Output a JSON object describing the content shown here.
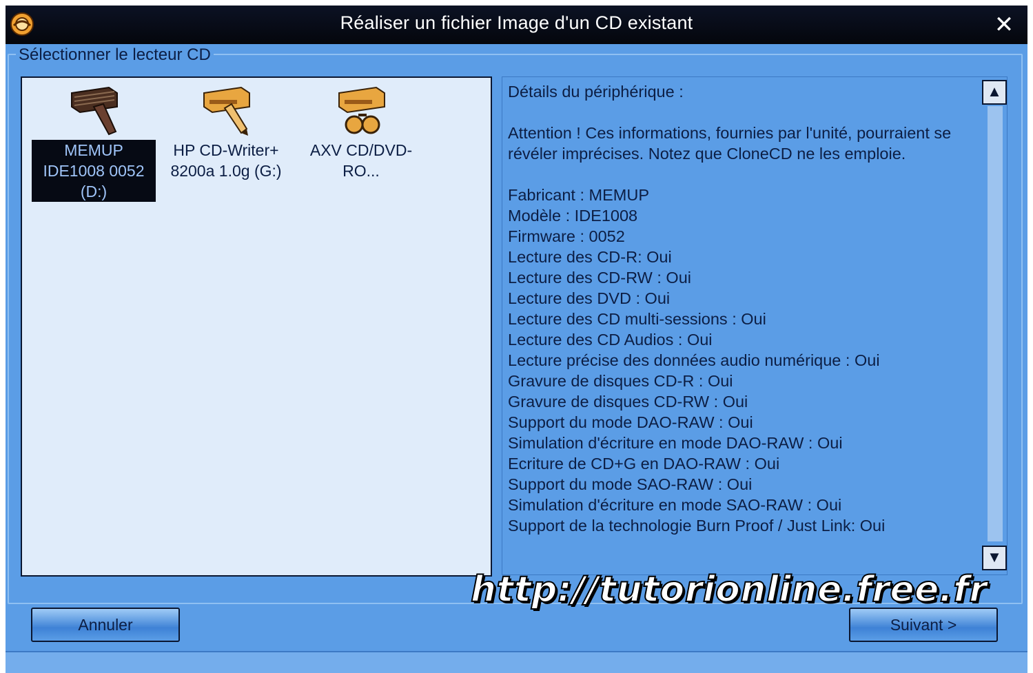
{
  "window": {
    "title": "Réaliser un fichier Image d'un CD existant",
    "close_glyph": "✕",
    "icon": "app-icon"
  },
  "group": {
    "legend": "Sélectionner le lecteur CD"
  },
  "drives": [
    {
      "icon": "cd-drive-icon",
      "label": "MEMUP IDE1008 0052 (D:)",
      "selected": true
    },
    {
      "icon": "cd-writer-icon",
      "label": "HP CD-Writer+ 8200a 1.0g (G:)",
      "selected": false
    },
    {
      "icon": "virtual-drive-icon",
      "label": "AXV CD/DVD-RO...",
      "selected": false
    }
  ],
  "details": {
    "heading": "Détails du périphérique :",
    "warning": "Attention ! Ces informations, fournies par l'unité, pourraient se révéler imprécises. Notez que CloneCD ne les emploie.",
    "lines": [
      "Fabricant : MEMUP",
      "Modèle : IDE1008",
      "Firmware : 0052",
      "Lecture des CD-R: Oui",
      "Lecture des CD-RW : Oui",
      "Lecture des DVD : Oui",
      "Lecture des CD multi-sessions : Oui",
      "Lecture des CD Audios : Oui",
      "Lecture précise des données audio numérique : Oui",
      "Gravure de disques CD-R : Oui",
      "Gravure de disques CD-RW : Oui",
      "Support du mode DAO-RAW : Oui",
      "Simulation d'écriture en mode DAO-RAW : Oui",
      "Ecriture de CD+G en DAO-RAW : Oui",
      "Support du mode SAO-RAW : Oui",
      "Simulation d'écriture en mode SAO-RAW : Oui",
      "Support de la technologie Burn Proof / Just Link: Oui"
    ],
    "scroll_up_glyph": "▲",
    "scroll_down_glyph": "▼"
  },
  "watermark": "http://tutorionline.free.fr",
  "buttons": {
    "cancel": "Annuler",
    "next": "Suivant >"
  },
  "colors": {
    "window_bg": "#5b9de6",
    "titlebar": "#04060c",
    "list_bg": "#e0ecfa",
    "selection": "#060a14",
    "icon_orange": "#e8a640"
  }
}
